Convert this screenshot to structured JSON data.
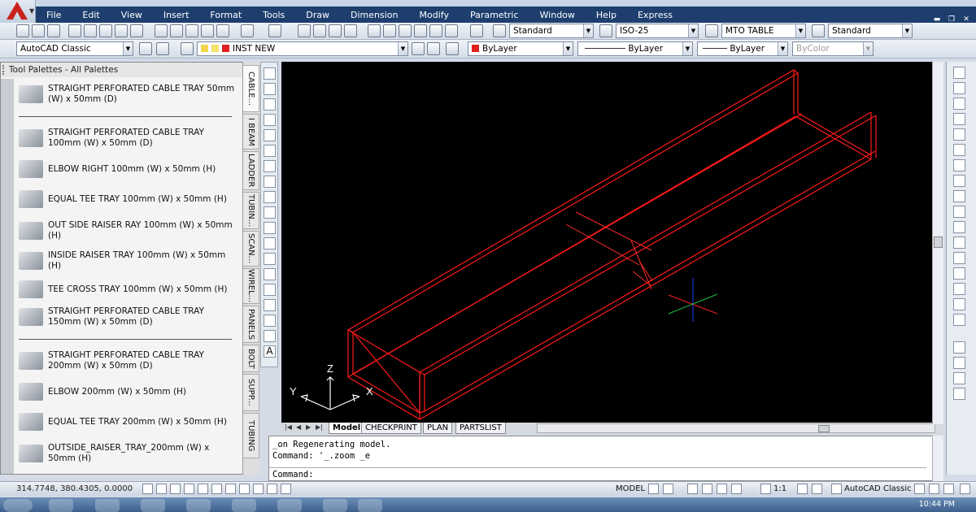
{
  "menu": [
    "File",
    "Edit",
    "View",
    "Insert",
    "Format",
    "Tools",
    "Draw",
    "Dimension",
    "Modify",
    "Parametric",
    "Window",
    "Help",
    "Express"
  ],
  "toolbar1": {
    "text_style": "Standard",
    "dim_style": "ISO-25",
    "table_style": "MTO TABLE",
    "multileader_style": "Standard"
  },
  "toolbar2": {
    "workspace": "AutoCAD Classic",
    "layer": "INST NEW",
    "layer_color": "#e02020",
    "color": "ByLayer",
    "linetype": "ByLayer",
    "lineweight": "ByLayer",
    "plotstyle": "ByColor"
  },
  "tool_palette": {
    "title": "Tool Palettes - All Palettes",
    "items": [
      "STRAIGHT PERFORATED CABLE TRAY 50mm (W) x 50mm (D)",
      "STRAIGHT PERFORATED CABLE TRAY 100mm (W) x 50mm (D)",
      "ELBOW RIGHT  100mm (W) x 50mm (H)",
      "EQUAL TEE TRAY 100mm (W) x 50mm (H)",
      "OUT SIDE RAISER RAY 100mm (W) x 50mm (H)",
      "INSIDE RAISER TRAY 100mm (W) x 50mm (H)",
      "TEE CROSS TRAY 100mm (W) x 50mm (H)",
      "STRAIGHT PERFORATED CABLE TRAY 150mm (W) x 50mm (D)",
      "STRAIGHT PERFORATED CABLE TRAY 200mm (W) x 50mm (D)",
      "ELBOW 200mm (W) x 50mm (H)",
      "EQUAL TEE TRAY 200mm (W) x 50mm (H)",
      "OUTSIDE_RAISER_TRAY_200mm (W) x 50mm (H)"
    ],
    "tabs": [
      "CABLE...",
      "I BEAM",
      "LADDER",
      "TUBIN...",
      "SCAN...",
      "WIREL...",
      "PANELS",
      "BOLT",
      "SUPP...",
      "TUBING"
    ]
  },
  "canvas": {
    "axis_x": "X",
    "axis_y": "Y",
    "axis_z": "Z"
  },
  "layout_tabs": [
    "Model",
    "CHECKPRINT",
    "PLAN",
    "PARTSLIST"
  ],
  "command_line": {
    "line1": "_on Regenerating model.",
    "line2": "Command: '_.zoom _e",
    "prompt": "Command:"
  },
  "status": {
    "coords": "314.7748, 380.4305, 0.0000",
    "model": "MODEL",
    "scale": "1:1",
    "workspace": "AutoCAD Classic"
  },
  "clock": "10:44 PM"
}
